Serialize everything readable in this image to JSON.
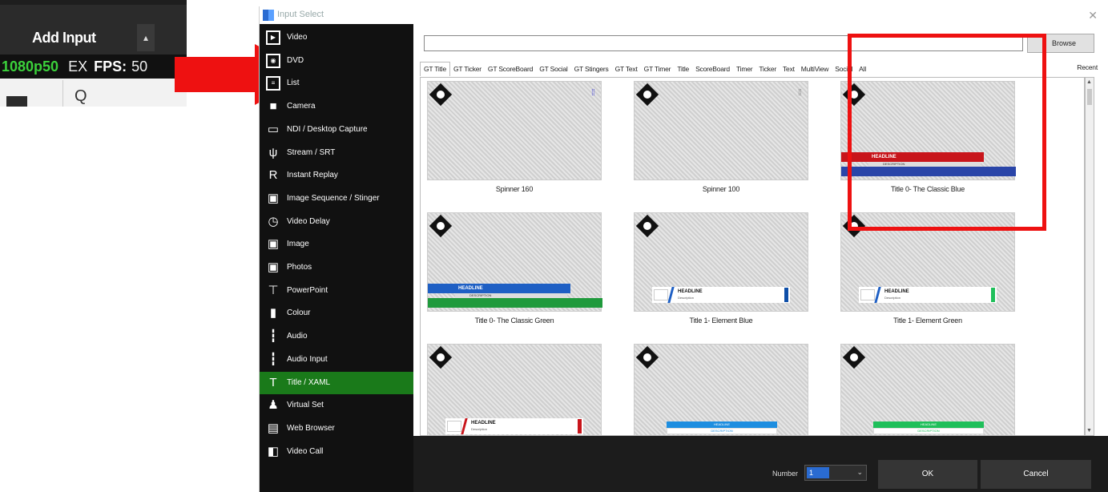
{
  "vmix": {
    "add_input_label": "Add Input",
    "dropdown_glyph": "▴",
    "resolution": "1080p50",
    "ex_label": "EX",
    "fps_label": "FPS:",
    "fps_value": "50",
    "search_glyph": "Q"
  },
  "dialog": {
    "title": "Input Select",
    "close_glyph": "✕",
    "sidebar": [
      {
        "label": "Video",
        "icon": "video-icon",
        "glyph": "▶"
      },
      {
        "label": "DVD",
        "icon": "dvd-icon",
        "glyph": "◉"
      },
      {
        "label": "List",
        "icon": "list-icon",
        "glyph": "≡"
      },
      {
        "label": "Camera",
        "icon": "camera-icon",
        "glyph": "■"
      },
      {
        "label": "NDI / Desktop Capture",
        "icon": "monitor-icon",
        "glyph": "▭"
      },
      {
        "label": "Stream / SRT",
        "icon": "antenna-icon",
        "glyph": "ψ"
      },
      {
        "label": "Instant Replay",
        "icon": "replay-icon",
        "glyph": "R"
      },
      {
        "label": "Image Sequence / Stinger",
        "icon": "image-sequence-icon",
        "glyph": "▣"
      },
      {
        "label": "Video Delay",
        "icon": "clock-icon",
        "glyph": "◷"
      },
      {
        "label": "Image",
        "icon": "image-icon",
        "glyph": "▣"
      },
      {
        "label": "Photos",
        "icon": "photos-icon",
        "glyph": "▣"
      },
      {
        "label": "PowerPoint",
        "icon": "projector-icon",
        "glyph": "⊤"
      },
      {
        "label": "Colour",
        "icon": "colour-icon",
        "glyph": "▮"
      },
      {
        "label": "Audio",
        "icon": "audio-icon",
        "glyph": "┇"
      },
      {
        "label": "Audio Input",
        "icon": "audio-input-icon",
        "glyph": "┇"
      },
      {
        "label": "Title / XAML",
        "icon": "title-icon",
        "glyph": "T"
      },
      {
        "label": "Virtual Set",
        "icon": "virtual-set-icon",
        "glyph": "♟"
      },
      {
        "label": "Web Browser",
        "icon": "browser-icon",
        "glyph": "▤"
      },
      {
        "label": "Video Call",
        "icon": "video-call-icon",
        "glyph": "◧"
      }
    ],
    "browse_label": "Browse",
    "tabs": [
      "GT Title",
      "GT Ticker",
      "GT ScoreBoard",
      "GT Social",
      "GT Stingers",
      "GT Text",
      "GT Timer",
      "Title",
      "ScoreBoard",
      "Timer",
      "Ticker",
      "Text",
      "MultiView",
      "Social",
      "All"
    ],
    "recent_tab": "Recent",
    "templates": [
      {
        "caption": "Spinner 160",
        "style": "spinner",
        "mark": "⁞⁞"
      },
      {
        "caption": "Spinner 100",
        "style": "spinner-grey",
        "mark": "⁞⁞"
      },
      {
        "caption": "Title 0- The Classic Blue",
        "style": "classic",
        "headline": "HEADLINE",
        "description": "DESCRIPTION",
        "top_color": "#c8151b",
        "bottom_color": "#2a45a8"
      },
      {
        "caption": "Title 0- The Classic Green",
        "style": "classic",
        "headline": "HEADLINE",
        "description": "DESCRIPTION",
        "top_color": "#1e5fc4",
        "bottom_color": "#1f9a3c"
      },
      {
        "caption": "Title 1- Element Blue",
        "style": "element",
        "headline": "HEADLINE",
        "sub": "Description",
        "accent": "#1e5fc4",
        "end": "#0e4fa8"
      },
      {
        "caption": "Title 1- Element Green",
        "style": "element",
        "headline": "HEADLINE",
        "sub": "Description",
        "accent": "#1e5fc4",
        "end": "#1fbf5a"
      },
      {
        "caption": "",
        "style": "element",
        "headline": "HEADLINE",
        "sub": "Description",
        "accent": "#c8151b",
        "end": "#c8151b"
      },
      {
        "caption": "",
        "style": "slim",
        "headline": "HEADLINE",
        "sub": "DESCRIPTION",
        "accent": "#1e8ee0"
      },
      {
        "caption": "",
        "style": "slim",
        "headline": "HEADLINE",
        "sub": "DESCRIPTION",
        "accent": "#1fbf5a"
      }
    ],
    "number_label": "Number",
    "number_value": "1",
    "ok_label": "OK",
    "cancel_label": "Cancel",
    "highlight_color": "#ee1111",
    "active_color": "#1a7a1a"
  }
}
